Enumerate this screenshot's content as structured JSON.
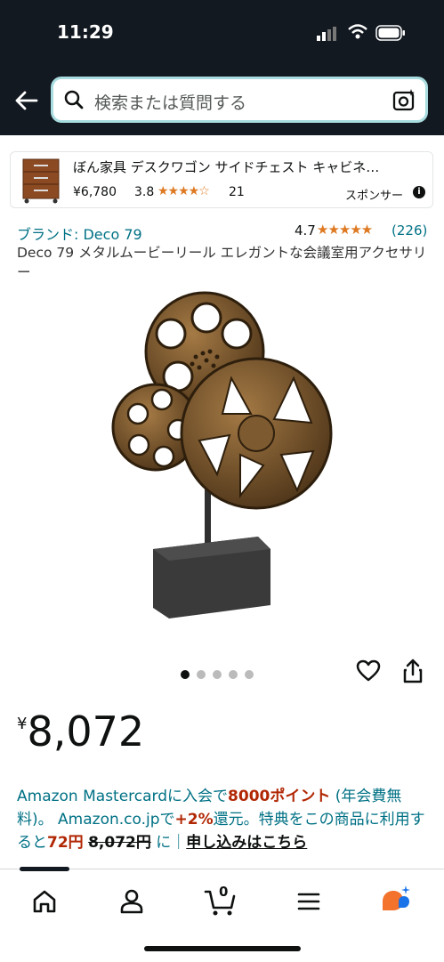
{
  "status_bar": {
    "time": "11:29"
  },
  "search": {
    "placeholder": "検索または質問する"
  },
  "sponsored": {
    "title": "ぼん家具 デスクワゴン サイドチェスト キャビネ…",
    "price": "¥6,780",
    "rating": "3.8",
    "stars": "★★★★☆",
    "review_count": "21",
    "label": "スポンサー",
    "info_icon": "i"
  },
  "product": {
    "brand": "ブランド: Deco 79",
    "rating": "4.7",
    "stars": "★★★★★",
    "review_count": "(226)",
    "title": "Deco 79 メタルムービーリール エレガントな会議室用アクセサリー",
    "image_count": 5,
    "active_image_index": 0,
    "price_symbol": "¥",
    "price": "8,072"
  },
  "promo": {
    "text1": "Amazon Mastercardに入会で",
    "points": "8000ポイント",
    "text2": " (年会費無料)。 Amazon.co.jpで",
    "plus": "+2%",
    "text3": "還元。特典をこの商品に利用すると",
    "discounted": "72円",
    "space": " ",
    "original": "8,072円",
    "text4": " に｜",
    "apply_link": "申し込みはこちら"
  },
  "tabbar": {
    "cart_count": "0",
    "icons": [
      "home-icon",
      "account-icon",
      "cart-icon",
      "menu-icon",
      "rufus-icon"
    ]
  },
  "colors": {
    "header_bg": "#131921",
    "link": "#007185",
    "star": "#de7921",
    "price_red": "#b12704",
    "rufus_orange": "#f3722c",
    "rufus_blue": "#1a73e8"
  }
}
